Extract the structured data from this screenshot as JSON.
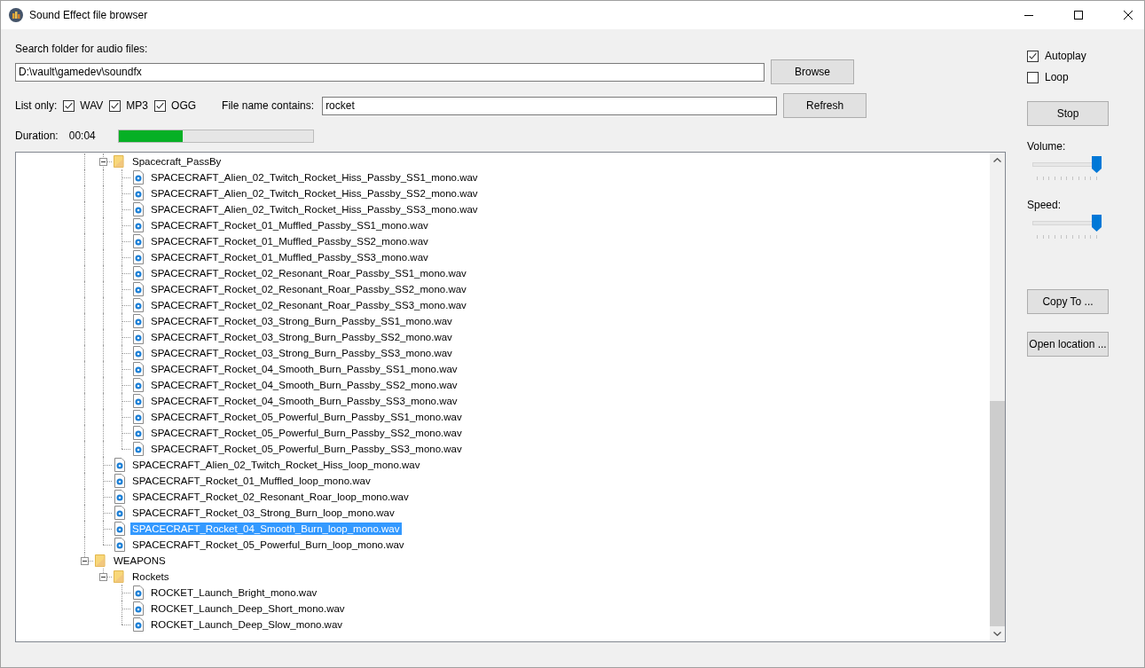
{
  "window": {
    "title": "Sound Effect file browser"
  },
  "search": {
    "label": "Search folder for audio files:",
    "path": "D:\\vault\\gamedev\\soundfx",
    "browse_button": "Browse"
  },
  "filters": {
    "label": "List only:",
    "types": [
      {
        "label": "WAV",
        "checked": true
      },
      {
        "label": "MP3",
        "checked": true
      },
      {
        "label": "OGG",
        "checked": true
      }
    ],
    "name_label": "File name contains:",
    "name_value": "rocket",
    "refresh_button": "Refresh"
  },
  "duration": {
    "label": "Duration:",
    "value": "00:04",
    "level": 0.33
  },
  "tree": {
    "nodes": [
      {
        "children": [
          {
            "kind": "folder",
            "label": "Spacecraft_PassBy",
            "expanded": true,
            "selected": false,
            "children": [
              {
                "kind": "file",
                "label": "SPACECRAFT_Alien_02_Twitch_Rocket_Hiss_Passby_SS1_mono.wav",
                "selected": false
              },
              {
                "kind": "file",
                "label": "SPACECRAFT_Alien_02_Twitch_Rocket_Hiss_Passby_SS2_mono.wav",
                "selected": false
              },
              {
                "kind": "file",
                "label": "SPACECRAFT_Alien_02_Twitch_Rocket_Hiss_Passby_SS3_mono.wav",
                "selected": false
              },
              {
                "kind": "file",
                "label": "SPACECRAFT_Rocket_01_Muffled_Passby_SS1_mono.wav",
                "selected": false
              },
              {
                "kind": "file",
                "label": "SPACECRAFT_Rocket_01_Muffled_Passby_SS2_mono.wav",
                "selected": false
              },
              {
                "kind": "file",
                "label": "SPACECRAFT_Rocket_01_Muffled_Passby_SS3_mono.wav",
                "selected": false
              },
              {
                "kind": "file",
                "label": "SPACECRAFT_Rocket_02_Resonant_Roar_Passby_SS1_mono.wav",
                "selected": false
              },
              {
                "kind": "file",
                "label": "SPACECRAFT_Rocket_02_Resonant_Roar_Passby_SS2_mono.wav",
                "selected": false
              },
              {
                "kind": "file",
                "label": "SPACECRAFT_Rocket_02_Resonant_Roar_Passby_SS3_mono.wav",
                "selected": false
              },
              {
                "kind": "file",
                "label": "SPACECRAFT_Rocket_03_Strong_Burn_Passby_SS1_mono.wav",
                "selected": false
              },
              {
                "kind": "file",
                "label": "SPACECRAFT_Rocket_03_Strong_Burn_Passby_SS2_mono.wav",
                "selected": false
              },
              {
                "kind": "file",
                "label": "SPACECRAFT_Rocket_03_Strong_Burn_Passby_SS3_mono.wav",
                "selected": false
              },
              {
                "kind": "file",
                "label": "SPACECRAFT_Rocket_04_Smooth_Burn_Passby_SS1_mono.wav",
                "selected": false
              },
              {
                "kind": "file",
                "label": "SPACECRAFT_Rocket_04_Smooth_Burn_Passby_SS2_mono.wav",
                "selected": false
              },
              {
                "kind": "file",
                "label": "SPACECRAFT_Rocket_04_Smooth_Burn_Passby_SS3_mono.wav",
                "selected": false
              },
              {
                "kind": "file",
                "label": "SPACECRAFT_Rocket_05_Powerful_Burn_Passby_SS1_mono.wav",
                "selected": false
              },
              {
                "kind": "file",
                "label": "SPACECRAFT_Rocket_05_Powerful_Burn_Passby_SS2_mono.wav",
                "selected": false
              },
              {
                "kind": "file",
                "label": "SPACECRAFT_Rocket_05_Powerful_Burn_Passby_SS3_mono.wav",
                "selected": false
              }
            ]
          },
          {
            "kind": "file",
            "label": "SPACECRAFT_Alien_02_Twitch_Rocket_Hiss_loop_mono.wav",
            "selected": false
          },
          {
            "kind": "file",
            "label": "SPACECRAFT_Rocket_01_Muffled_loop_mono.wav",
            "selected": false
          },
          {
            "kind": "file",
            "label": "SPACECRAFT_Rocket_02_Resonant_Roar_loop_mono.wav",
            "selected": false
          },
          {
            "kind": "file",
            "label": "SPACECRAFT_Rocket_03_Strong_Burn_loop_mono.wav",
            "selected": false
          },
          {
            "kind": "file",
            "label": "SPACECRAFT_Rocket_04_Smooth_Burn_loop_mono.wav",
            "selected": true
          },
          {
            "kind": "file",
            "label": "SPACECRAFT_Rocket_05_Powerful_Burn_loop_mono.wav",
            "selected": false
          }
        ]
      },
      {
        "kind": "folder",
        "label": "WEAPONS",
        "expanded": true,
        "selected": false,
        "children": [
          {
            "kind": "folder",
            "label": "Rockets",
            "expanded": true,
            "selected": false,
            "children": [
              {
                "kind": "file",
                "label": "ROCKET_Launch_Bright_mono.wav",
                "selected": false
              },
              {
                "kind": "file",
                "label": "ROCKET_Launch_Deep_Short_mono.wav",
                "selected": false
              },
              {
                "kind": "file",
                "label": "ROCKET_Launch_Deep_Slow_mono.wav",
                "selected": false
              }
            ]
          }
        ]
      }
    ]
  },
  "playback": {
    "options": [
      {
        "label": "Autoplay",
        "checked": true
      },
      {
        "label": "Loop",
        "checked": false
      }
    ],
    "stop_button": "Stop",
    "sliders": [
      {
        "label": "Volume:",
        "level": 1
      },
      {
        "label": "Speed:",
        "level": 1
      }
    ],
    "copy_button": "Copy To ...",
    "open_button": "Open location ..."
  }
}
